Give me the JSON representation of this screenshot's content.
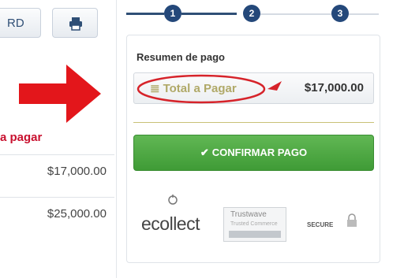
{
  "left": {
    "partial_button_label": "RD",
    "print_icon": "printer-icon",
    "arrow_color": "#e3161b",
    "pagar_label": "a pagar",
    "rows": [
      {
        "value": "$17,000.00"
      },
      {
        "value": "$25,000.00"
      }
    ]
  },
  "steps": [
    {
      "number": "1",
      "state": "active"
    },
    {
      "number": "2",
      "state": "pending"
    },
    {
      "number": "3",
      "state": "pending"
    }
  ],
  "summary": {
    "title": "Resumen de pago",
    "total_label": "Total a Pagar",
    "total_value": "$17,000.00",
    "highlight_color": "#d6232a",
    "confirm_label": "CONFIRMAR PAGO",
    "confirm_icon": "check-circle-icon",
    "confirm_color": "#4caa3f"
  },
  "logos": {
    "ecollect": "ecollect",
    "trust_name": "Trustwave",
    "trust_sub": "Trusted Commerce",
    "secure": "SECURE"
  }
}
